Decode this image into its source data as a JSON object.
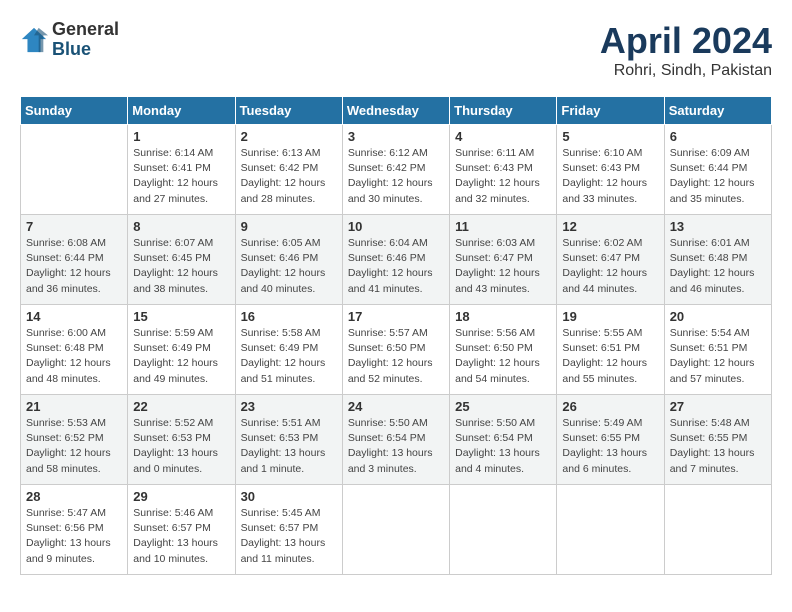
{
  "header": {
    "logo_general": "General",
    "logo_blue": "Blue",
    "title": "April 2024",
    "subtitle": "Rohri, Sindh, Pakistan"
  },
  "columns": [
    "Sunday",
    "Monday",
    "Tuesday",
    "Wednesday",
    "Thursday",
    "Friday",
    "Saturday"
  ],
  "weeks": [
    [
      {
        "day": "",
        "info": ""
      },
      {
        "day": "1",
        "info": "Sunrise: 6:14 AM\nSunset: 6:41 PM\nDaylight: 12 hours\nand 27 minutes."
      },
      {
        "day": "2",
        "info": "Sunrise: 6:13 AM\nSunset: 6:42 PM\nDaylight: 12 hours\nand 28 minutes."
      },
      {
        "day": "3",
        "info": "Sunrise: 6:12 AM\nSunset: 6:42 PM\nDaylight: 12 hours\nand 30 minutes."
      },
      {
        "day": "4",
        "info": "Sunrise: 6:11 AM\nSunset: 6:43 PM\nDaylight: 12 hours\nand 32 minutes."
      },
      {
        "day": "5",
        "info": "Sunrise: 6:10 AM\nSunset: 6:43 PM\nDaylight: 12 hours\nand 33 minutes."
      },
      {
        "day": "6",
        "info": "Sunrise: 6:09 AM\nSunset: 6:44 PM\nDaylight: 12 hours\nand 35 minutes."
      }
    ],
    [
      {
        "day": "7",
        "info": "Sunrise: 6:08 AM\nSunset: 6:44 PM\nDaylight: 12 hours\nand 36 minutes."
      },
      {
        "day": "8",
        "info": "Sunrise: 6:07 AM\nSunset: 6:45 PM\nDaylight: 12 hours\nand 38 minutes."
      },
      {
        "day": "9",
        "info": "Sunrise: 6:05 AM\nSunset: 6:46 PM\nDaylight: 12 hours\nand 40 minutes."
      },
      {
        "day": "10",
        "info": "Sunrise: 6:04 AM\nSunset: 6:46 PM\nDaylight: 12 hours\nand 41 minutes."
      },
      {
        "day": "11",
        "info": "Sunrise: 6:03 AM\nSunset: 6:47 PM\nDaylight: 12 hours\nand 43 minutes."
      },
      {
        "day": "12",
        "info": "Sunrise: 6:02 AM\nSunset: 6:47 PM\nDaylight: 12 hours\nand 44 minutes."
      },
      {
        "day": "13",
        "info": "Sunrise: 6:01 AM\nSunset: 6:48 PM\nDaylight: 12 hours\nand 46 minutes."
      }
    ],
    [
      {
        "day": "14",
        "info": "Sunrise: 6:00 AM\nSunset: 6:48 PM\nDaylight: 12 hours\nand 48 minutes."
      },
      {
        "day": "15",
        "info": "Sunrise: 5:59 AM\nSunset: 6:49 PM\nDaylight: 12 hours\nand 49 minutes."
      },
      {
        "day": "16",
        "info": "Sunrise: 5:58 AM\nSunset: 6:49 PM\nDaylight: 12 hours\nand 51 minutes."
      },
      {
        "day": "17",
        "info": "Sunrise: 5:57 AM\nSunset: 6:50 PM\nDaylight: 12 hours\nand 52 minutes."
      },
      {
        "day": "18",
        "info": "Sunrise: 5:56 AM\nSunset: 6:50 PM\nDaylight: 12 hours\nand 54 minutes."
      },
      {
        "day": "19",
        "info": "Sunrise: 5:55 AM\nSunset: 6:51 PM\nDaylight: 12 hours\nand 55 minutes."
      },
      {
        "day": "20",
        "info": "Sunrise: 5:54 AM\nSunset: 6:51 PM\nDaylight: 12 hours\nand 57 minutes."
      }
    ],
    [
      {
        "day": "21",
        "info": "Sunrise: 5:53 AM\nSunset: 6:52 PM\nDaylight: 12 hours\nand 58 minutes."
      },
      {
        "day": "22",
        "info": "Sunrise: 5:52 AM\nSunset: 6:53 PM\nDaylight: 13 hours\nand 0 minutes."
      },
      {
        "day": "23",
        "info": "Sunrise: 5:51 AM\nSunset: 6:53 PM\nDaylight: 13 hours\nand 1 minute."
      },
      {
        "day": "24",
        "info": "Sunrise: 5:50 AM\nSunset: 6:54 PM\nDaylight: 13 hours\nand 3 minutes."
      },
      {
        "day": "25",
        "info": "Sunrise: 5:50 AM\nSunset: 6:54 PM\nDaylight: 13 hours\nand 4 minutes."
      },
      {
        "day": "26",
        "info": "Sunrise: 5:49 AM\nSunset: 6:55 PM\nDaylight: 13 hours\nand 6 minutes."
      },
      {
        "day": "27",
        "info": "Sunrise: 5:48 AM\nSunset: 6:55 PM\nDaylight: 13 hours\nand 7 minutes."
      }
    ],
    [
      {
        "day": "28",
        "info": "Sunrise: 5:47 AM\nSunset: 6:56 PM\nDaylight: 13 hours\nand 9 minutes."
      },
      {
        "day": "29",
        "info": "Sunrise: 5:46 AM\nSunset: 6:57 PM\nDaylight: 13 hours\nand 10 minutes."
      },
      {
        "day": "30",
        "info": "Sunrise: 5:45 AM\nSunset: 6:57 PM\nDaylight: 13 hours\nand 11 minutes."
      },
      {
        "day": "",
        "info": ""
      },
      {
        "day": "",
        "info": ""
      },
      {
        "day": "",
        "info": ""
      },
      {
        "day": "",
        "info": ""
      }
    ]
  ]
}
